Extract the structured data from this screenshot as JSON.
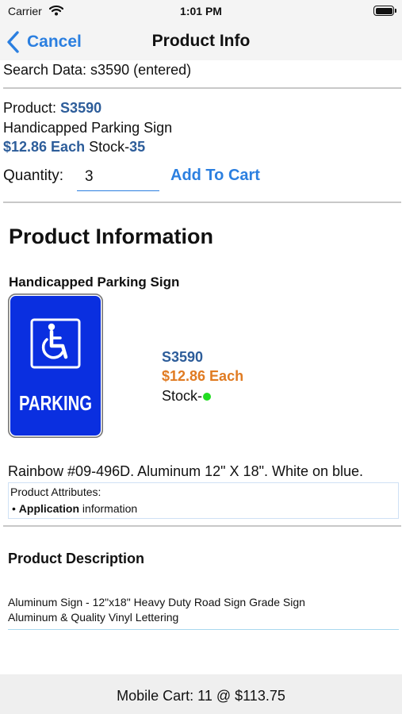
{
  "status_bar": {
    "carrier": "Carrier",
    "time": "1:01 PM"
  },
  "nav": {
    "back_label": "Cancel",
    "title": "Product Info"
  },
  "search": {
    "text": "Search Data: s3590 (entered)"
  },
  "product": {
    "label": "Product: ",
    "sku": "S3590",
    "name": "Handicapped Parking Sign",
    "price": "$12.86 Each",
    "stock_label": " Stock-",
    "stock_count": "35"
  },
  "quantity": {
    "label": "Quantity:",
    "value": "3",
    "add_button": "Add To Cart"
  },
  "info": {
    "heading": "Product Information",
    "subheading": "Handicapped Parking Sign",
    "sign_text": "PARKING",
    "sku": "S3590",
    "price": "$12.86 Each",
    "stock_label": "Stock-",
    "description": "Rainbow #09-496D. Aluminum 12\" X 18\". White on blue.",
    "attributes_title": "Product Attributes:",
    "attr_bullet": "•",
    "attr_key": "Application",
    "attr_value": "information"
  },
  "description": {
    "heading": "Product Description",
    "line1": "Aluminum Sign - 12\"x18\" Heavy Duty Road Sign Grade Sign",
    "line2": "Aluminum & Quality Vinyl Lettering"
  },
  "footer": {
    "cart_text": "Mobile Cart: 11 @ $113.75"
  },
  "colors": {
    "accent": "#2b7fe0",
    "product_blue": "#2d5d9a",
    "price_orange": "#e07b22",
    "sign_blue": "#0a2fe0",
    "stock_green": "#22dd22"
  }
}
